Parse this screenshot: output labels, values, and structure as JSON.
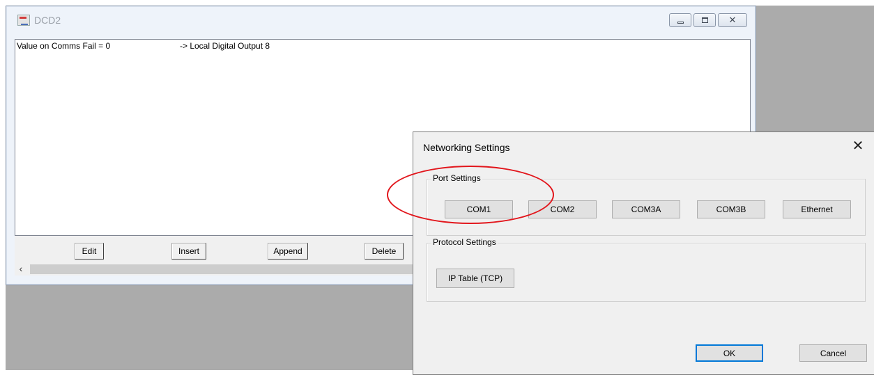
{
  "main_window": {
    "title": "DCD2",
    "list": {
      "rows": [
        {
          "col1": "Value on Comms Fail = 0",
          "col2": "-> Local Digital Output 8"
        }
      ]
    },
    "buttons": {
      "edit": "Edit",
      "insert": "Insert",
      "append": "Append",
      "delete": "Delete"
    },
    "scroll_left_glyph": "‹"
  },
  "dialog": {
    "title": "Networking Settings",
    "close_glyph": "✕",
    "port_settings": {
      "legend": "Port Settings",
      "buttons": [
        "COM1",
        "COM2",
        "COM3A",
        "COM3B",
        "Ethernet"
      ]
    },
    "protocol_settings": {
      "legend": "Protocol Settings",
      "ip_table_label": "IP Table (TCP)"
    },
    "ok_label": "OK",
    "cancel_label": "Cancel"
  },
  "colors": {
    "annotation": "#e2161c",
    "default_button_border": "#0078d7"
  }
}
